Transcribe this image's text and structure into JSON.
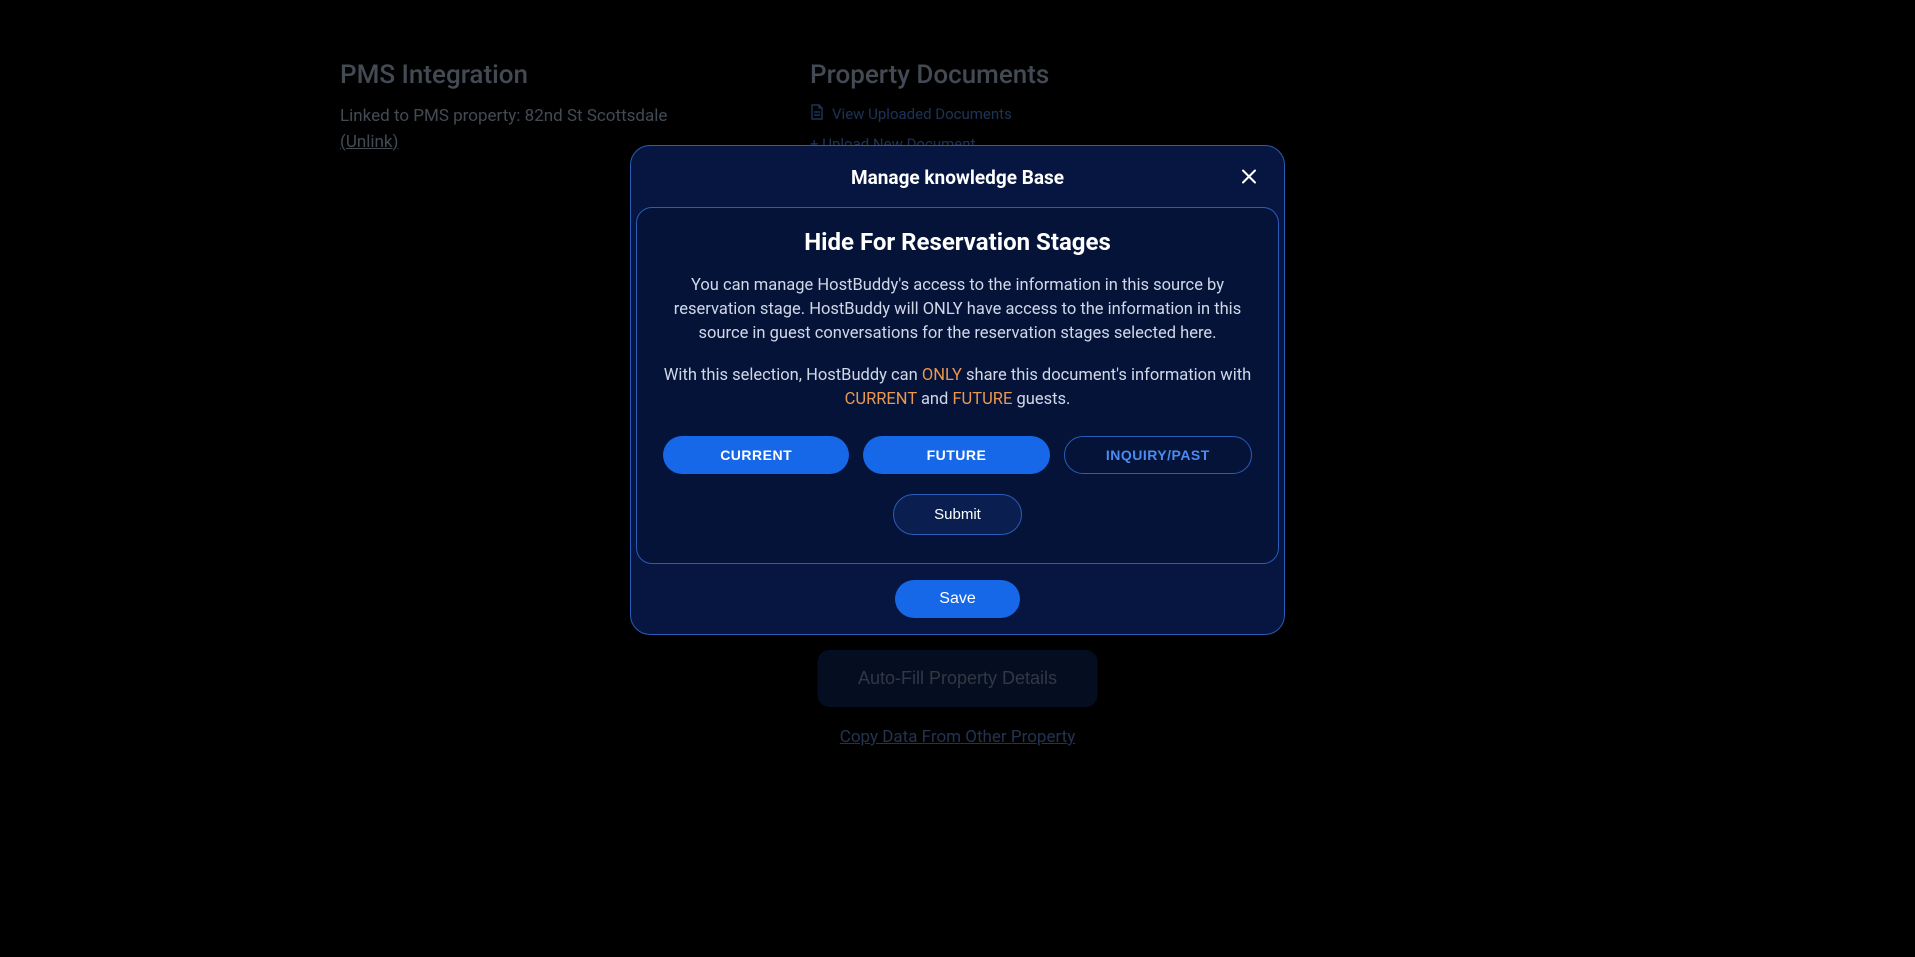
{
  "background": {
    "pms": {
      "heading": "PMS Integration",
      "linked_text": "Linked to PMS property: 82nd St Scottsdale",
      "unlink_label": "(Unlink)"
    },
    "documents": {
      "heading": "Property Documents",
      "view_label": "View Uploaded Documents",
      "upload_label": "+ Upload New Document"
    },
    "autofill_label": "Auto-Fill Property Details",
    "copy_label": "Copy Data From Other Property"
  },
  "modal": {
    "title": "Manage knowledge Base",
    "card": {
      "title": "Hide For Reservation Stages",
      "desc1": "You can manage HostBuddy's access to the information in this source by reservation stage. HostBuddy will ONLY have access to the information in this source in guest conversations for the reservation stages selected here.",
      "desc2_pre": "With this selection, HostBuddy can ",
      "desc2_only": "ONLY",
      "desc2_mid1": " share this document's information with ",
      "desc2_current": "CURRENT",
      "desc2_and": " and ",
      "desc2_future": "FUTURE",
      "desc2_post": " guests.",
      "stages": {
        "current": "CURRENT",
        "future": "FUTURE",
        "inquiry_past": "INQUIRY/PAST"
      },
      "submit_label": "Submit"
    },
    "save_label": "Save"
  }
}
